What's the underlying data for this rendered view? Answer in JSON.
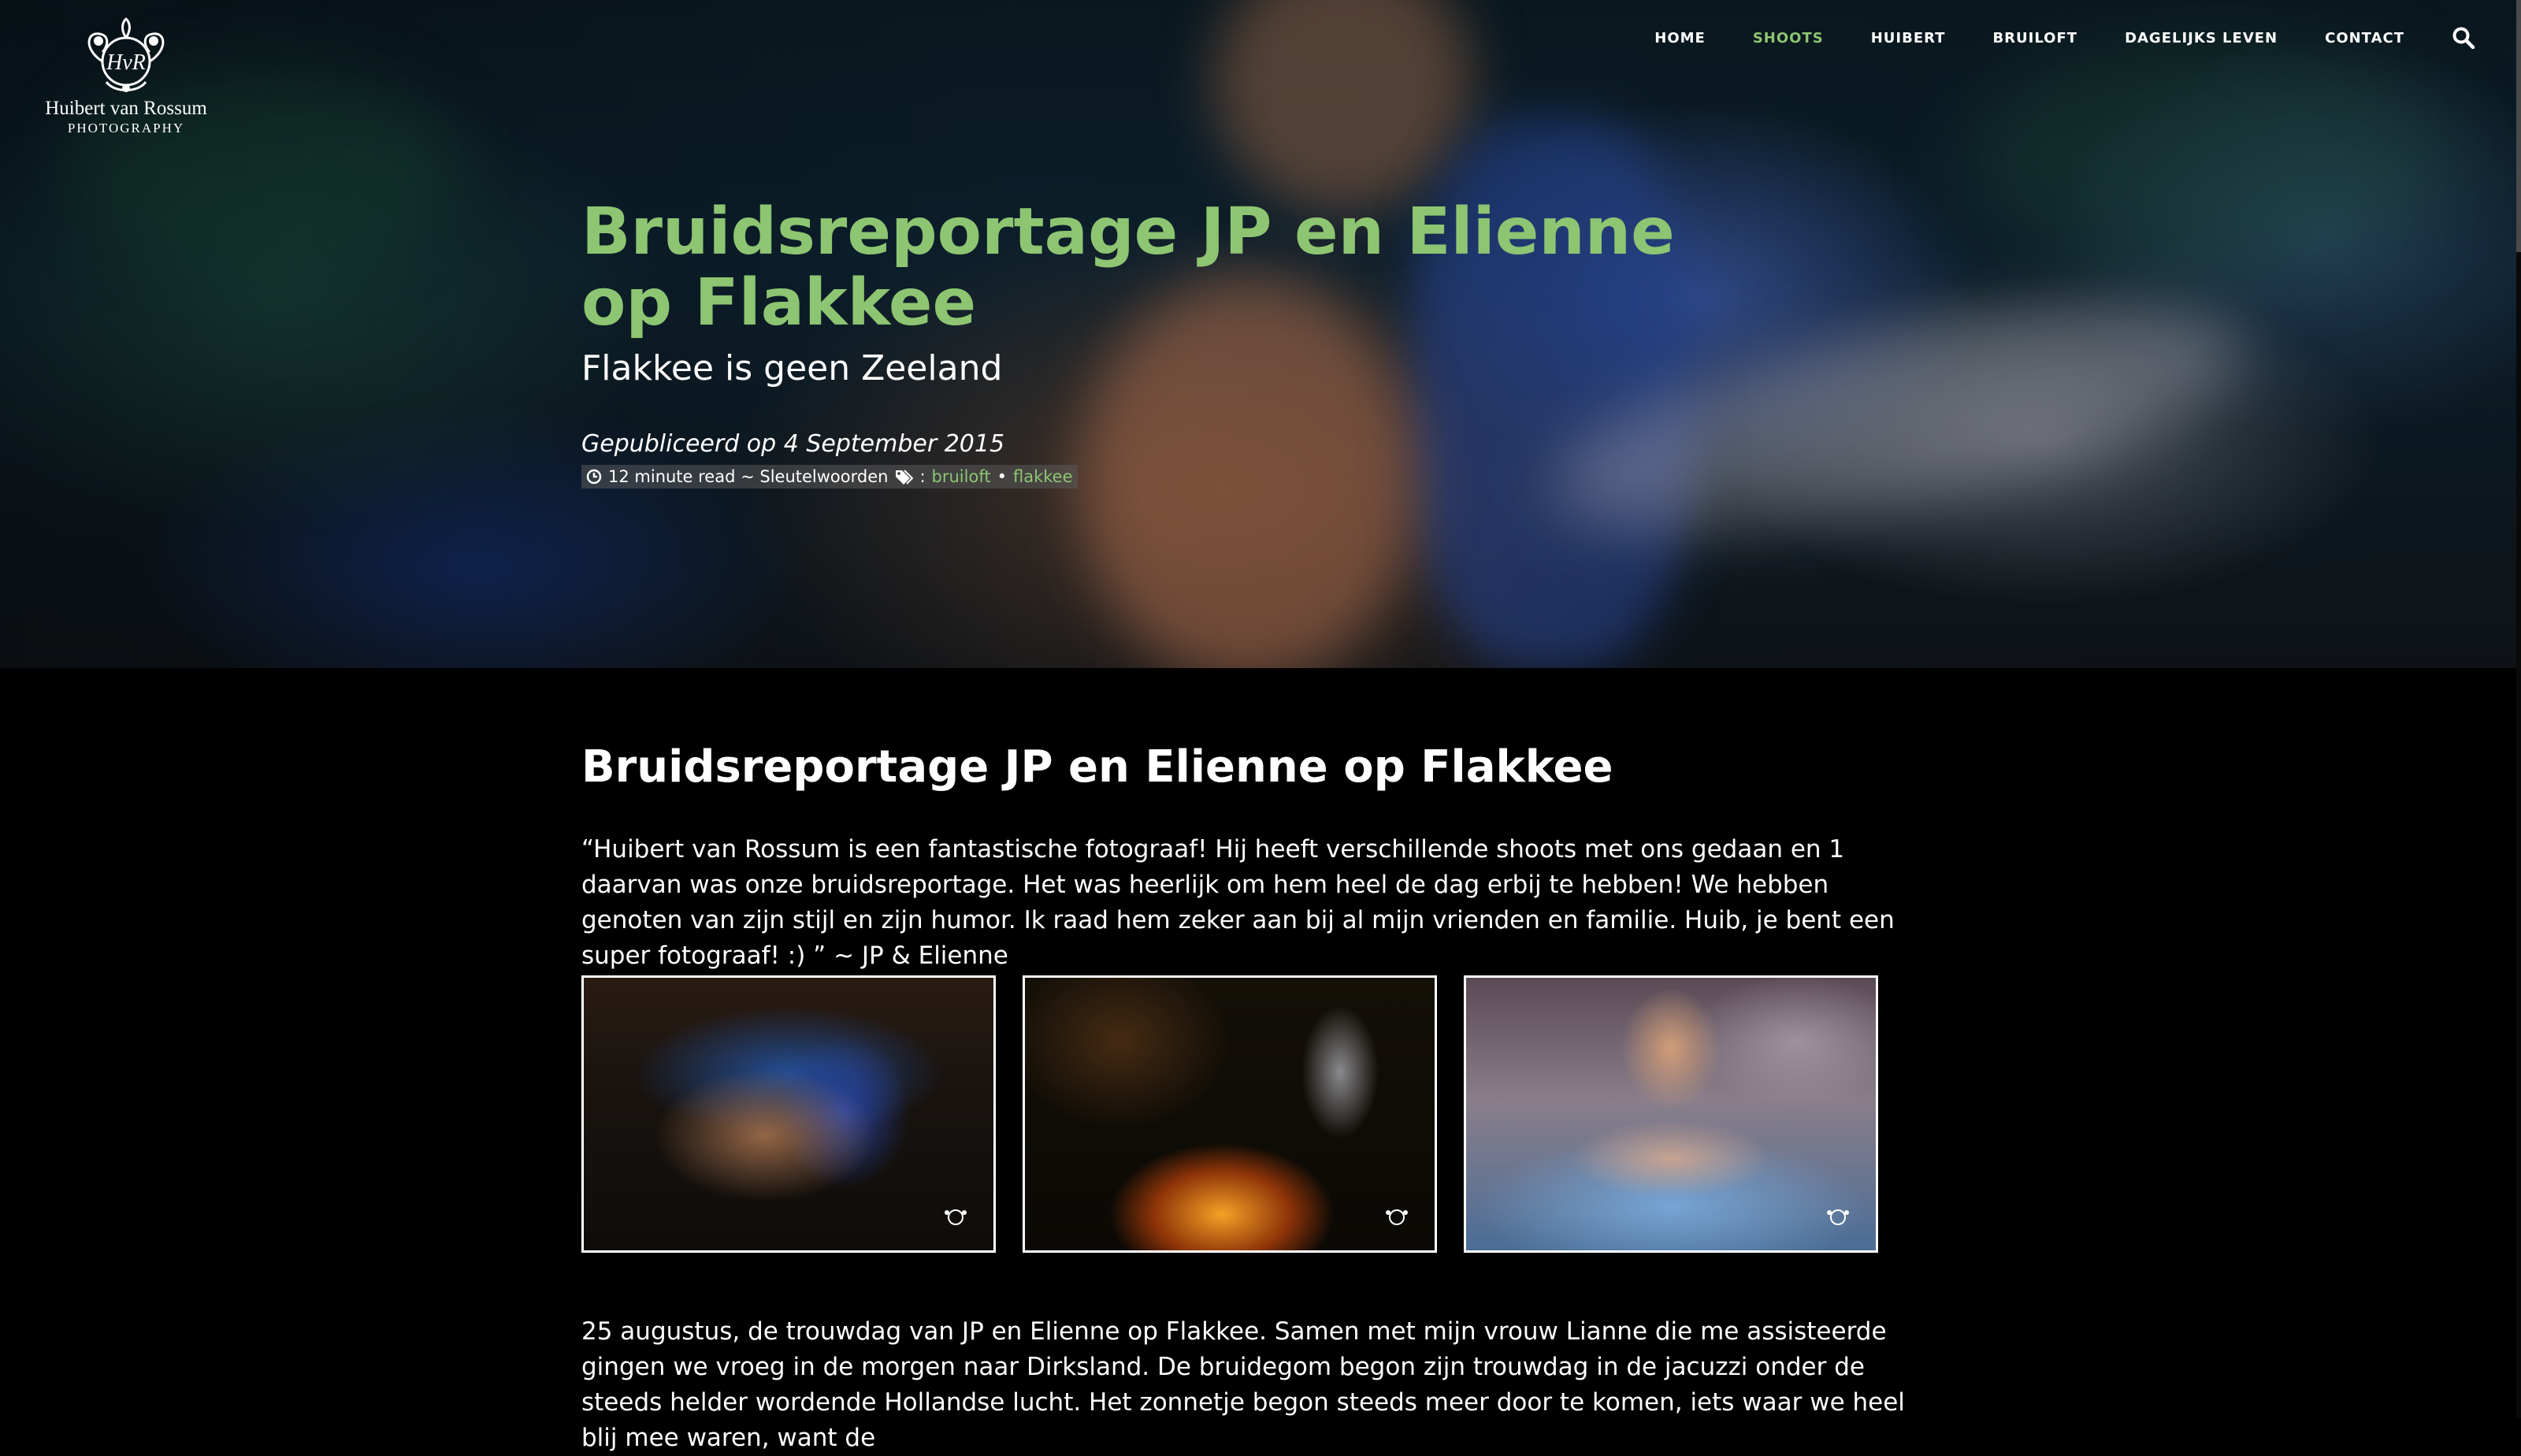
{
  "brand": {
    "monogram": "HvR",
    "name": "Huibert van Rossum",
    "sub": "PHOTOGRAPHY"
  },
  "nav": {
    "items": [
      {
        "label": "HOME",
        "active": false
      },
      {
        "label": "SHOOTS",
        "active": true
      },
      {
        "label": "HUIBERT",
        "active": false
      },
      {
        "label": "BRUILOFT",
        "active": false
      },
      {
        "label": "DAGELIJKS LEVEN",
        "active": false
      },
      {
        "label": "CONTACT",
        "active": false
      }
    ],
    "search_icon": "search-icon"
  },
  "colors": {
    "accent": "#8dc572",
    "background": "#000000",
    "text": "#ffffff"
  },
  "hero": {
    "title": "Bruidsreportage JP en Elienne op Flakkee",
    "subtitle": "Flakkee is geen Zeeland",
    "published": "Gepubliceerd op 4 September 2015",
    "read_time": "12 minute read ~ Sleutelwoorden",
    "tags_separator": ":",
    "tags": [
      "bruiloft",
      "flakkee"
    ],
    "tag_divider": "•"
  },
  "article": {
    "heading": "Bruidsreportage JP en Elienne op Flakkee",
    "quote": "“Huibert van Rossum is een fantastische fotograaf! Hij heeft verschillende shoots met ons gedaan en 1 daarvan was onze bruidsreportage. Het was heerlijk om hem heel de dag erbij te hebben! We hebben genoten van zijn stijl en zijn humor. Ik raad hem zeker aan bij al mijn vrienden en familie. Huib, je bent een super fotograaf! :) ” ~ JP & Elienne",
    "body": "25 augustus, de trouwdag van JP en Elienne op Flakkee. Samen met mijn vrouw Lianne die me assisteerde gingen we vroeg in de morgen naar Dirksland. De bruidegom begon zijn trouwdag in de jacuzzi onder de steeds helder wordende Hollandse lucht. Het zonnetje begon steeds meer door te komen, iets waar we heel blij mee waren, want de"
  }
}
